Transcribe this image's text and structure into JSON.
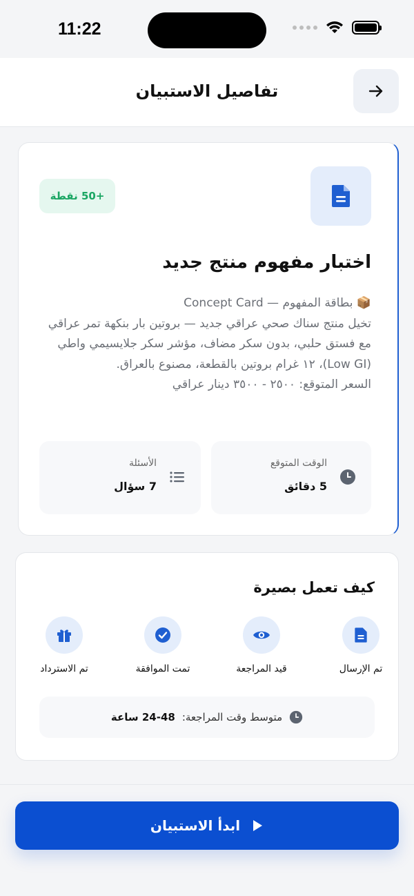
{
  "status_bar": {
    "time": "11:22"
  },
  "header": {
    "title": "تفاصيل الاستبيان"
  },
  "survey": {
    "points": "+50 نقطة",
    "title": "اختبار مفهوم منتج جديد",
    "description": "📦 بطاقة المفهوم — Concept Card\nتخيل منتج سناك صحي عراقي جديد — بروتين بار بنكهة تمر عراقي\nمع فستق حلبي، بدون سكر مضاف، مؤشر سكر جلايسيمي واطي\n(Low GI)، ١٢ غرام بروتين بالقطعة، مصنوع بالعراق.\nالسعر المتوقع: ٢٥٠٠ - ٣٥٠٠ دينار عراقي",
    "stats": {
      "time_label": "الوقت المتوقع",
      "time_value": "5 دقائق",
      "questions_label": "الأسئلة",
      "questions_value": "7 سؤال"
    }
  },
  "how_it_works": {
    "title": "كيف تعمل بصيرة",
    "steps": [
      {
        "label": "تم الإرسال",
        "icon": "document-icon"
      },
      {
        "label": "قيد المراجعة",
        "icon": "eye-icon"
      },
      {
        "label": "تمت الموافقة",
        "icon": "check-circle-icon"
      },
      {
        "label": "تم الاسترداد",
        "icon": "gift-icon"
      }
    ],
    "avg_review_label": "متوسط وقت المراجعة:",
    "avg_review_value": "24-48 ساعة"
  },
  "start_button": {
    "label": "ابدأ الاستبيان",
    "icon": "play-icon"
  },
  "colors": {
    "primary": "#0b4fd1",
    "accent_light": "#e4edfb",
    "points_green": "#1aa663",
    "points_bg": "#e5f7ef"
  }
}
